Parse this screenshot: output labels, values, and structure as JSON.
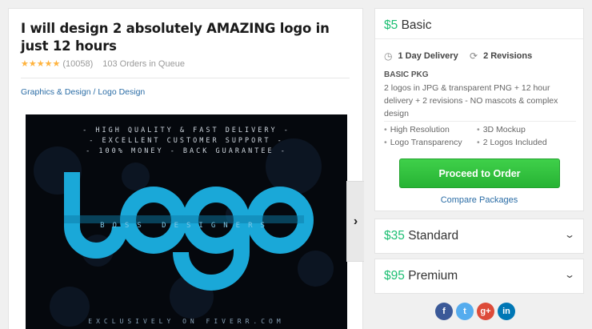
{
  "gig": {
    "title": "I will design 2 absolutely AMAZING logo in just 12 hours",
    "stars": "★★★★★",
    "review_count": "(10058)",
    "orders_in_queue": "103 Orders in Queue",
    "breadcrumb": {
      "category": "Graphics & Design",
      "separator": " / ",
      "subcategory": "Logo Design"
    }
  },
  "hero_image": {
    "taglines": [
      "- HIGH QUALITY & FAST DELIVERY -",
      "- EXCELLENT CUSTOMER SUPPORT -",
      "- 100% MONEY - BACK GUARANTEE -"
    ],
    "logo_word": "logo",
    "overlay_text": "BOSS DESIGNERS",
    "footer_text": "EXCLUSIVELY ON FIVERR.COM",
    "logo_color": "#1aa8d8"
  },
  "next_icon": "chevron-right-icon",
  "package": {
    "price": "$5",
    "name": "Basic",
    "delivery": "1 Day Delivery",
    "revisions": "2 Revisions",
    "title": "BASIC PKG",
    "description": "2 logos in JPG & transparent PNG + 12 hour delivery + 2 revisions - NO mascots & complex design",
    "features": [
      "High Resolution",
      "3D Mockup",
      "Logo Transparency",
      "2 Logos Included"
    ],
    "order_button": "Proceed to Order",
    "compare_link": "Compare Packages"
  },
  "other_packages": [
    {
      "price": "$35",
      "name": "Standard"
    },
    {
      "price": "$95",
      "name": "Premium"
    }
  ],
  "social": [
    {
      "icon": "facebook-icon",
      "glyph": "f",
      "color": "#3b5998"
    },
    {
      "icon": "twitter-icon",
      "glyph": "t",
      "color": "#55acee"
    },
    {
      "icon": "google-plus-icon",
      "glyph": "g+",
      "color": "#dd4b39"
    },
    {
      "icon": "linkedin-icon",
      "glyph": "in",
      "color": "#0077b5"
    }
  ],
  "colors": {
    "accent_green": "#1dbf73",
    "button_green": "#27b334",
    "link_blue": "#2b6da6",
    "star": "#ffb33e"
  }
}
